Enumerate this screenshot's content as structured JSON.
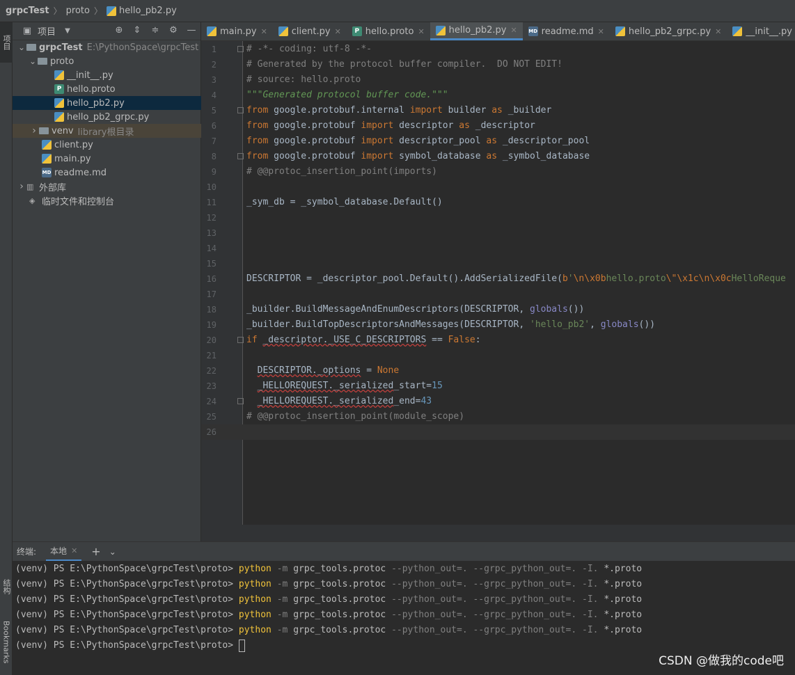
{
  "breadcrumb": [
    "grpcTest",
    "proto",
    "hello_pb2.py"
  ],
  "left_strip": {
    "project_tab": "项目",
    "structure_tab": "结构",
    "bookmarks_tab": "Bookmarks"
  },
  "project_pane": {
    "title": "项目",
    "tree": [
      {
        "label": "grpcTest",
        "hint": "E:\\PythonSpace\\grpcTest",
        "icon": "folder-icon",
        "expanded": true
      },
      {
        "label": "proto",
        "icon": "folder-icon",
        "expanded": true
      },
      {
        "label": "__init__.py",
        "icon": "python-file-icon"
      },
      {
        "label": "hello.proto",
        "icon": "proto-file-icon"
      },
      {
        "label": "hello_pb2.py",
        "icon": "python-file-icon",
        "selected": true
      },
      {
        "label": "hello_pb2_grpc.py",
        "icon": "python-file-icon"
      },
      {
        "label": "venv",
        "hint": "library根目录",
        "icon": "folder-icon",
        "expanded": false
      },
      {
        "label": "client.py",
        "icon": "python-file-icon"
      },
      {
        "label": "main.py",
        "icon": "python-file-icon"
      },
      {
        "label": "readme.md",
        "icon": "markdown-file-icon"
      },
      {
        "label": "外部库",
        "icon": "library-icon",
        "expanded": false
      },
      {
        "label": "临时文件和控制台",
        "icon": "scratch-icon"
      }
    ]
  },
  "tabs": [
    {
      "label": "main.py",
      "icon": "python-file-icon"
    },
    {
      "label": "client.py",
      "icon": "python-file-icon"
    },
    {
      "label": "hello.proto",
      "icon": "proto-file-icon"
    },
    {
      "label": "hello_pb2.py",
      "icon": "python-file-icon",
      "active": true
    },
    {
      "label": "readme.md",
      "icon": "markdown-file-icon"
    },
    {
      "label": "hello_pb2_grpc.py",
      "icon": "python-file-icon"
    },
    {
      "label": "__init__.py",
      "icon": "python-file-icon"
    }
  ],
  "editor": {
    "current_line": 26,
    "lines": [
      "# -*- coding: utf-8 -*-",
      "# Generated by the protocol buffer compiler.  DO NOT EDIT!",
      "# source: hello.proto",
      "\"\"\"Generated protocol buffer code.\"\"\"",
      "from google.protobuf.internal import builder as _builder",
      "from google.protobuf import descriptor as _descriptor",
      "from google.protobuf import descriptor_pool as _descriptor_pool",
      "from google.protobuf import symbol_database as _symbol_database",
      "# @@protoc_insertion_point(imports)",
      "",
      "_sym_db = _symbol_database.Default()",
      "",
      "",
      "",
      "",
      "DESCRIPTOR = _descriptor_pool.Default().AddSerializedFile(b'\\n\\x0bhello.proto\\\"\\x1c\\n\\x0cHelloReque",
      "",
      "_builder.BuildMessageAndEnumDescriptors(DESCRIPTOR, globals())",
      "_builder.BuildTopDescriptorsAndMessages(DESCRIPTOR, 'hello_pb2', globals())",
      "if _descriptor._USE_C_DESCRIPTORS == False:",
      "",
      "  DESCRIPTOR._options = None",
      "  _HELLOREQUEST._serialized_start=15",
      "  _HELLOREQUEST._serialized_end=43",
      "# @@protoc_insertion_point(module_scope)",
      ""
    ]
  },
  "terminal": {
    "label": "终端:",
    "tab": "本地",
    "prompt": "(venv) PS E:\\PythonSpace\\grpcTest\\proto> ",
    "cmd_python": "python",
    "cmd_m": "-m",
    "cmd_module": "grpc_tools.protoc",
    "cmd_flags": "--python_out=. --grpc_python_out=. -I.",
    "cmd_target": "*.proto",
    "command_count": 5
  },
  "watermark": "CSDN @做我的code吧",
  "colors": {
    "accent": "#4a88c7",
    "keyword": "#cc7832",
    "comment": "#808080",
    "string": "#6a8759",
    "number": "#6897bb"
  }
}
